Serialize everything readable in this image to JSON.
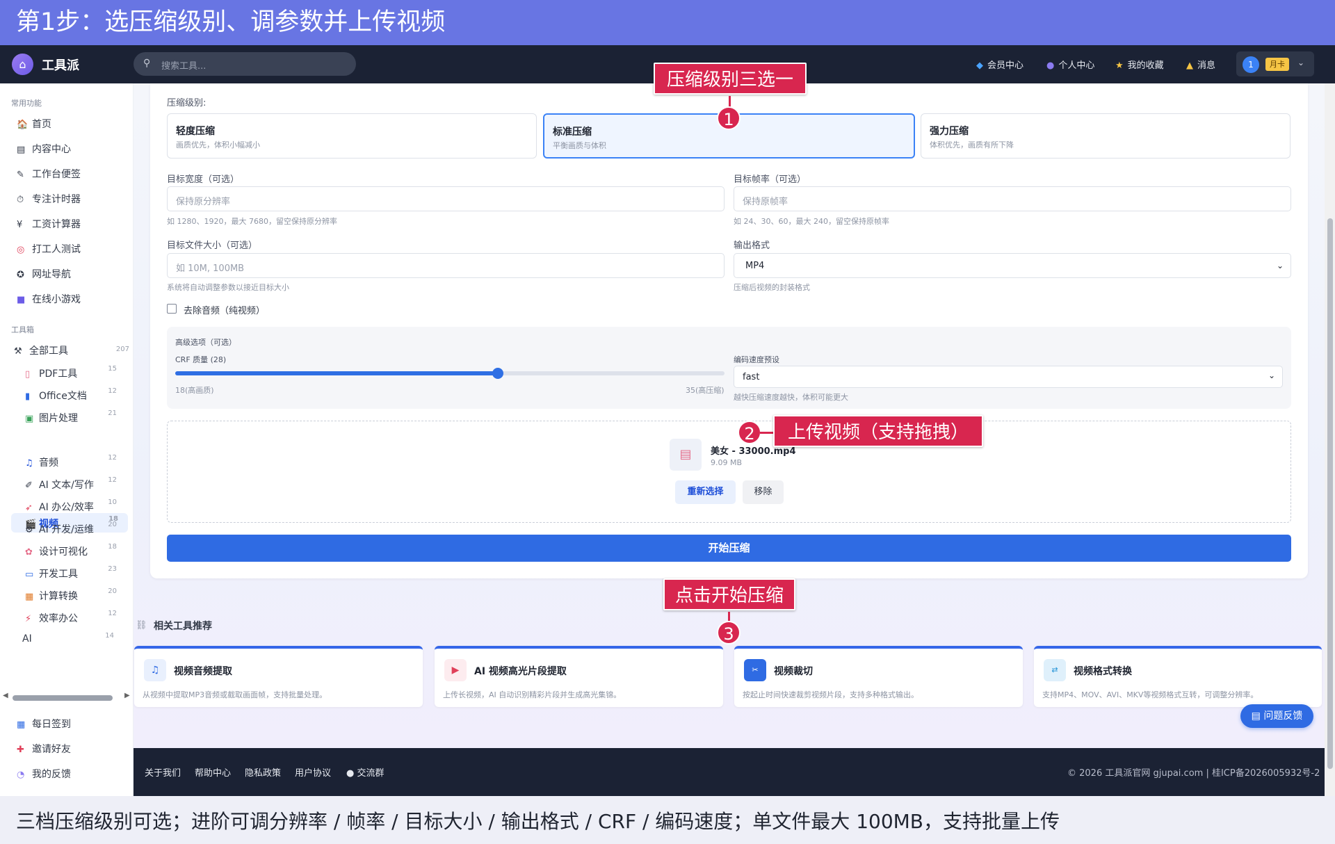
{
  "banner": {
    "title": "第1步：选压缩级别、调参数并上传视频"
  },
  "caption": {
    "text": "三档压缩级别可选；进阶可调分辨率 / 帧率 / 目标大小 / 输出格式 / CRF / 编码速度；单文件最大 100MB，支持批量上传"
  },
  "topnav": {
    "brand": "工具派",
    "search_placeholder": "搜索工具...",
    "links": [
      {
        "label": "会员中心",
        "icon": "diamond-icon"
      },
      {
        "label": "个人中心",
        "icon": "user-icon"
      },
      {
        "label": "我的收藏",
        "icon": "star-icon"
      },
      {
        "label": "消息",
        "icon": "bell-icon"
      }
    ],
    "user_number": "1",
    "user_badge": "月卡"
  },
  "sidebar": {
    "common_title": "常用功能",
    "common_items": [
      {
        "label": "首页",
        "icon": "home-icon"
      },
      {
        "label": "内容中心",
        "icon": "content-icon"
      },
      {
        "label": "工作台便签",
        "icon": "note-icon"
      },
      {
        "label": "专注计时器",
        "icon": "timer-icon"
      },
      {
        "label": "工资计算器",
        "icon": "money-icon"
      },
      {
        "label": "打工人测试",
        "icon": "target-icon"
      },
      {
        "label": "网址导航",
        "icon": "compass-icon"
      },
      {
        "label": "在线小游戏",
        "icon": "gamepad-icon"
      }
    ],
    "toolbox_title": "工具箱",
    "all_tools": {
      "label": "全部工具",
      "count": "207"
    },
    "tool_items": [
      {
        "label": "PDF工具",
        "count": "15",
        "icon": "pdf-icon"
      },
      {
        "label": "Office文档",
        "count": "12",
        "icon": "office-icon"
      },
      {
        "label": "图片处理",
        "count": "21",
        "icon": "image-icon"
      },
      {
        "label": "视频",
        "count": "18",
        "icon": "video-icon"
      },
      {
        "label": "音频",
        "count": "12",
        "icon": "music-icon"
      },
      {
        "label": "AI 文本/写作",
        "count": "12",
        "icon": "ai-write-icon"
      },
      {
        "label": "AI 办公/效率",
        "count": "10",
        "icon": "ai-office-icon"
      },
      {
        "label": "AI 开发/运维",
        "count": "20",
        "icon": "ai-dev-icon"
      },
      {
        "label": "设计可视化",
        "count": "18",
        "icon": "palette-icon"
      },
      {
        "label": "开发工具",
        "count": "23",
        "icon": "dev-icon"
      },
      {
        "label": "计算转换",
        "count": "20",
        "icon": "calc-icon"
      },
      {
        "label": "效率办公",
        "count": "12",
        "icon": "bolt-icon"
      },
      {
        "label": "AI",
        "count": "14",
        "icon": ""
      }
    ],
    "bottom_items": [
      {
        "label": "每日签到",
        "icon": "calendar-icon"
      },
      {
        "label": "邀请好友",
        "icon": "gift-icon"
      },
      {
        "label": "我的反馈",
        "icon": "chat-icon"
      }
    ]
  },
  "form": {
    "level_label": "压缩级别:",
    "levels": [
      {
        "title": "轻度压缩",
        "desc": "画质优先，体积小幅减小"
      },
      {
        "title": "标准压缩",
        "desc": "平衡画质与体积"
      },
      {
        "title": "强力压缩",
        "desc": "体积优先，画质有所下降"
      }
    ],
    "selected_level": 1,
    "width_label": "目标宽度（可选）",
    "width_placeholder": "保持原分辨率",
    "width_hint": "如 1280、1920，最大 7680，留空保持原分辨率",
    "fps_label": "目标帧率（可选）",
    "fps_placeholder": "保持原帧率",
    "fps_hint": "如 24、30、60，最大 240，留空保持原帧率",
    "size_label": "目标文件大小（可选）",
    "size_placeholder": "如 10M, 100MB",
    "size_hint": "系统将自动调整参数以接近目标大小",
    "format_label": "输出格式",
    "format_value": "MP4",
    "format_hint": "压缩后视频的封装格式",
    "remove_audio_label": "去除音频（纯视频）",
    "remove_audio_checked": false,
    "advanced_title": "高级选项（可选）",
    "crf_label": "CRF 质量 (28)",
    "crf_value": 28,
    "crf_min_label": "18(高画质)",
    "crf_max_label": "35(高压缩)",
    "preset_label": "编码速度预设",
    "preset_value": "fast",
    "preset_hint": "越快压缩速度越快，体积可能更大",
    "file_name": "美女 - 33000.mp4",
    "file_size": "9.09 MB",
    "rechoose_label": "重新选择",
    "remove_label": "移除",
    "start_label": "开始压缩"
  },
  "annotations": [
    {
      "num": "1",
      "text": "压缩级别三选一"
    },
    {
      "num": "2",
      "text": "上传视频（支持拖拽）"
    },
    {
      "num": "3",
      "text": "点击开始压缩"
    }
  ],
  "related": {
    "title": "相关工具推荐",
    "cards": [
      {
        "title": "视频音频提取",
        "desc": "从视频中提取MP3音频或截取画面帧，支持批量处理。",
        "icon": "music-note-icon"
      },
      {
        "title": "AI 视频高光片段提取",
        "desc": "上传长视频，AI 自动识别精彩片段并生成高光集锦。",
        "icon": "film-icon"
      },
      {
        "title": "视频裁切",
        "desc": "按起止时间快速裁剪视频片段，支持多种格式输出。",
        "icon": "crop-icon"
      },
      {
        "title": "视频格式转换",
        "desc": "支持MP4、MOV、AVI、MKV等视频格式互转，可调整分辨率。",
        "icon": "convert-icon"
      }
    ]
  },
  "feedback_button": "问题反馈",
  "footer": {
    "links": [
      "关于我们",
      "帮助中心",
      "隐私政策",
      "用户协议",
      "交流群"
    ],
    "copyright": "© 2026 工具派官网 gjupai.com | 桂ICP备2026005932号-2"
  },
  "colors": {
    "accent": "#2f6be3",
    "annotation": "#d8264f",
    "banner": "#6875e3",
    "nav": "#1b2234"
  }
}
